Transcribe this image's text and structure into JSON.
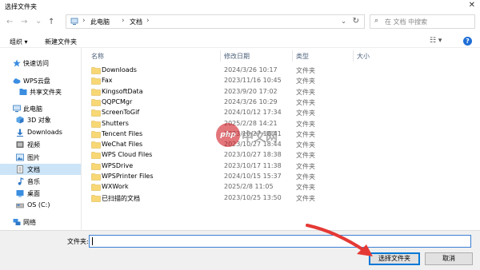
{
  "window": {
    "title": "选择文件夹",
    "close_glyph": "✕"
  },
  "nav": {
    "back": "←",
    "forward": "→",
    "recent": "⌄",
    "up": "↑"
  },
  "address": {
    "crumbs": [
      "此电脑",
      "文档"
    ],
    "sep": "›",
    "dropdown": "⌄",
    "refresh": "↻"
  },
  "search": {
    "placeholder": "在 文档 中搜索",
    "icon": "⌕"
  },
  "toolbar": {
    "organize": "组织 ▾",
    "new_folder": "新建文件夹",
    "view": "☷ ▾",
    "help": "?"
  },
  "sidebar": [
    {
      "label": "快速访问",
      "icon": "star-icon"
    },
    {
      "label": "WPS云盘",
      "icon": "cloud-icon"
    },
    {
      "label": "共享文件夹",
      "icon": "shared-folder-icon"
    },
    {
      "label": "此电脑",
      "icon": "computer-icon"
    },
    {
      "label": "3D 对象",
      "icon": "cube-icon"
    },
    {
      "label": "Downloads",
      "icon": "download-icon"
    },
    {
      "label": "视频",
      "icon": "video-icon"
    },
    {
      "label": "图片",
      "icon": "picture-icon"
    },
    {
      "label": "文档",
      "icon": "document-icon",
      "selected": true
    },
    {
      "label": "音乐",
      "icon": "music-icon"
    },
    {
      "label": "桌面",
      "icon": "desktop-icon"
    },
    {
      "label": "OS (C:)",
      "icon": "drive-icon"
    },
    {
      "label": "网络",
      "icon": "network-icon"
    }
  ],
  "columns": {
    "name": "名称",
    "date": "修改日期",
    "type": "类型",
    "size": "大小"
  },
  "files": [
    {
      "name": "Downloads",
      "date": "2024/3/26 10:17",
      "type": "文件夹"
    },
    {
      "name": "Fax",
      "date": "2023/11/16 10:45",
      "type": "文件夹"
    },
    {
      "name": "KingsoftData",
      "date": "2023/9/20 17:02",
      "type": "文件夹"
    },
    {
      "name": "QQPCMgr",
      "date": "2024/3/26 10:29",
      "type": "文件夹"
    },
    {
      "name": "ScreenToGif",
      "date": "2024/10/12 17:34",
      "type": "文件夹"
    },
    {
      "name": "Shutters",
      "date": "2025/2/28 14:21",
      "type": "文件夹"
    },
    {
      "name": "Tencent Files",
      "date": "2023/10/27 18:41",
      "type": "文件夹"
    },
    {
      "name": "WeChat Files",
      "date": "2023/10/27 18:44",
      "type": "文件夹"
    },
    {
      "name": "WPS Cloud Files",
      "date": "2023/10/27 18:38",
      "type": "文件夹"
    },
    {
      "name": "WPSDrive",
      "date": "2023/10/17 11:38",
      "type": "文件夹"
    },
    {
      "name": "WPSPrinter Files",
      "date": "2024/10/15 15:37",
      "type": "文件夹"
    },
    {
      "name": "WXWork",
      "date": "2025/2/8 11:05",
      "type": "文件夹"
    },
    {
      "name": "已扫描的文档",
      "date": "2023/10/25 13:50",
      "type": "文件夹"
    }
  ],
  "watermark": {
    "logo": "php",
    "text": "中文网"
  },
  "footer": {
    "folder_label": "文件夹:",
    "folder_value": "",
    "select_button": "选择文件夹",
    "cancel_button": "取消"
  },
  "colors": {
    "accent": "#0078d7",
    "selection": "#cce4f7",
    "folder": "#f8d775",
    "arrow": "#e53935"
  }
}
